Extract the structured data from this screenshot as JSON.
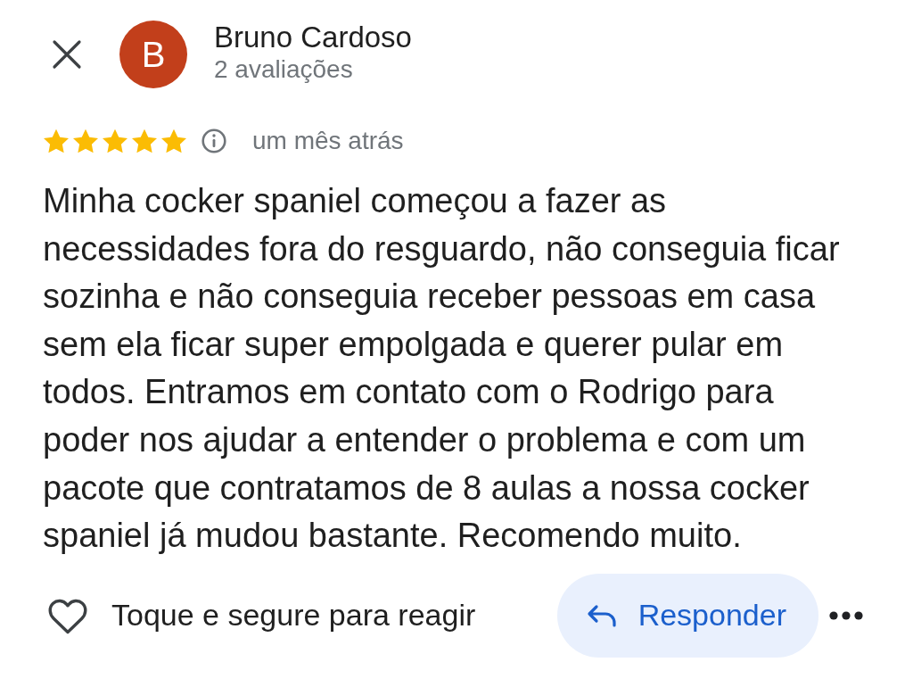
{
  "reviewer": {
    "initial": "B",
    "name": "Bruno Cardoso",
    "review_count": "2 avaliações"
  },
  "review": {
    "stars": 5,
    "time": "um mês atrás",
    "text": "Minha cocker spaniel começou a fazer as necessidades fora do resguardo, não conseguia ficar sozinha e não conseguia receber pessoas em casa sem ela ficar super empolgada e querer pular em todos. Entramos em contato com o Rodrigo para poder nos ajudar a entender o problema e com um pacote que contratamos de 8 aulas a nossa cocker spaniel já mudou bastante. Recomendo muito."
  },
  "actions": {
    "react_hint": "Toque e segure para reagir",
    "reply_button": "Responder"
  }
}
